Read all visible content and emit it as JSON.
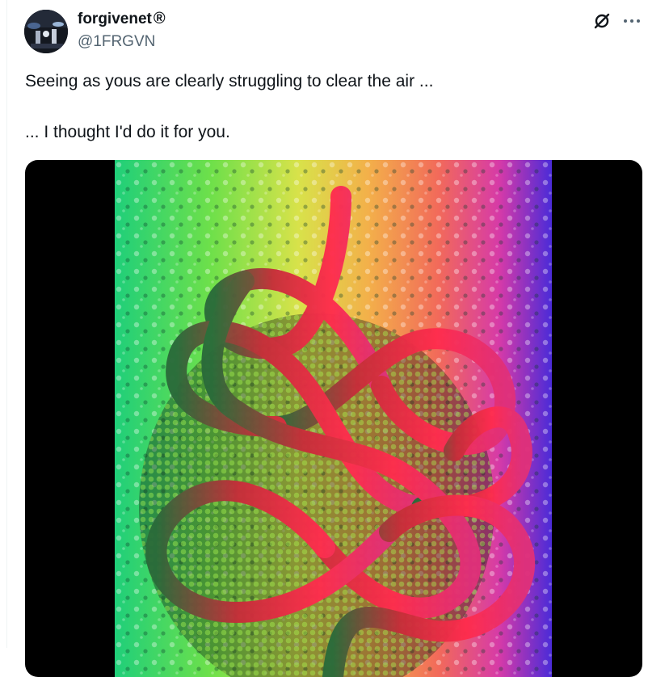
{
  "user": {
    "display_name": "forgivenet",
    "verified_symbol": "®",
    "handle": "@1FRGVN"
  },
  "tweet": {
    "line1": "Seeing as yous are clearly struggling to clear the air ...",
    "line2": "... I thought I'd do it for you."
  },
  "icons": {
    "grok": "grok-icon",
    "more": "more-icon"
  },
  "colors": {
    "text": "#0f1419",
    "secondary": "#536471",
    "media_bg": "#000000",
    "knot": "#e8243a"
  }
}
